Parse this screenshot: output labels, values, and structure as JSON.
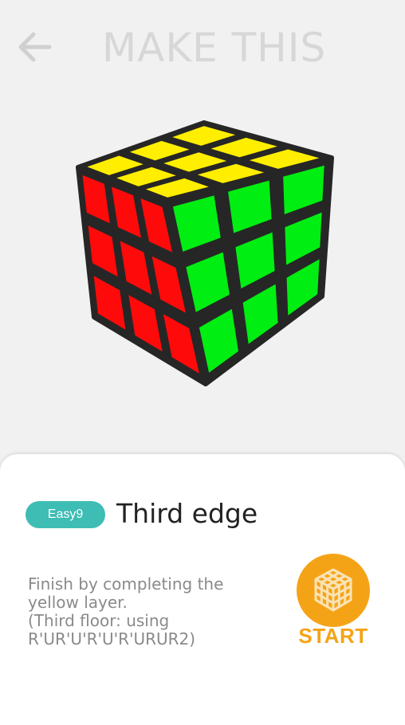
{
  "header": {
    "back_icon": "arrow-left-icon",
    "title": "MAKE THIS"
  },
  "cube": {
    "icon": "rubiks-cube-icon",
    "colors": {
      "top": "#ffee00",
      "left": "#ff0a0a",
      "right": "#00ee12",
      "frame": "#262626"
    }
  },
  "step": {
    "badge": "Easy9",
    "title": "Third edge",
    "description_lines": [
      "Finish by completing the",
      "yellow layer.",
      "(Third floor: using",
      "R'UR'U'R'U'R'URUR2)"
    ]
  },
  "start_button": {
    "label": "START",
    "icon": "cube-icon",
    "color": "#f5a316"
  },
  "colors": {
    "accent": "#3dbdb4",
    "background": "#f1f1f1"
  }
}
